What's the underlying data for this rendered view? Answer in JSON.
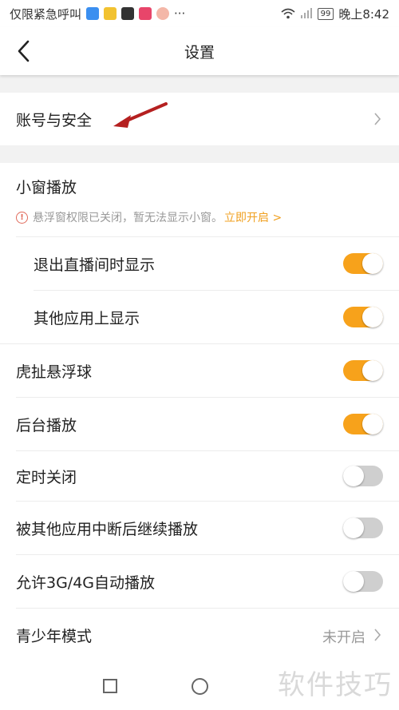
{
  "status_bar": {
    "left_text": "仅限紧急呼叫",
    "battery": "99",
    "time": "晚上8:42",
    "more_glyph": "···"
  },
  "nav": {
    "title": "设置",
    "back_icon": "chevron-left-icon"
  },
  "account": {
    "label": "账号与安全"
  },
  "mini_window": {
    "title": "小窗播放",
    "warning_text": "悬浮窗权限已关闭，暂无法显示小窗。",
    "warning_link": "立即开启 >",
    "warning_color": "#e06a5b",
    "link_color": "#f0a020"
  },
  "toggles": [
    {
      "label": "退出直播间时显示",
      "state": "on"
    },
    {
      "label": "其他应用上显示",
      "state": "on"
    },
    {
      "label": "虎扯悬浮球",
      "state": "on"
    },
    {
      "label": "后台播放",
      "state": "on"
    },
    {
      "label": "定时关闭",
      "state": "off"
    },
    {
      "label": "被其他应用中断后继续播放",
      "state": "off"
    },
    {
      "label": "允许3G/4G自动播放",
      "state": "off"
    }
  ],
  "teen_mode": {
    "label": "青少年模式",
    "value": "未开启"
  },
  "watermark": "软件技巧",
  "colors": {
    "accent": "#f7a21b",
    "toggle_off": "#cfcfcf",
    "arrow_annotation": "#b52020"
  }
}
